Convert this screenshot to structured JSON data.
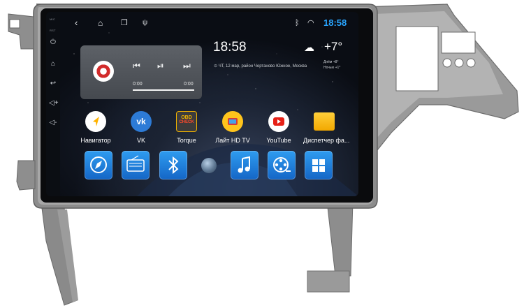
{
  "rail": {
    "mic_label": "MIC",
    "rst_label": "RST"
  },
  "status": {
    "time": "18:58"
  },
  "music": {
    "elapsed": "0:00",
    "total": "0:00",
    "progress": 0
  },
  "clock": {
    "time": "18:58",
    "date": "ЧТ, 12 мар, район Чертаново Южное, Москва"
  },
  "weather": {
    "temperature": "+7°",
    "day": "Днём +8°",
    "night": "Ночью +1°"
  },
  "apps": [
    {
      "label": "Навигатор",
      "icon": "navigator-icon"
    },
    {
      "label": "VK",
      "icon": "vk-icon"
    },
    {
      "label": "Torque",
      "icon": "obd-check-icon",
      "icon_text_top": "OBD",
      "icon_text_bottom": "CHECK"
    },
    {
      "label": "Лайт HD TV",
      "icon": "tv-icon"
    },
    {
      "label": "YouTube",
      "icon": "youtube-icon"
    },
    {
      "label": "Диспетчер фа...",
      "icon": "folder-icon"
    }
  ],
  "dock": [
    "compass-icon",
    "radio-icon",
    "bluetooth-icon",
    "circle-button-icon",
    "music-note-icon",
    "video-reel-icon",
    "apps-grid-icon"
  ],
  "colors": {
    "accent": "#29a5ff",
    "dock_blue": "#1a7fe0",
    "frame_gray": "#8f8f8f"
  }
}
